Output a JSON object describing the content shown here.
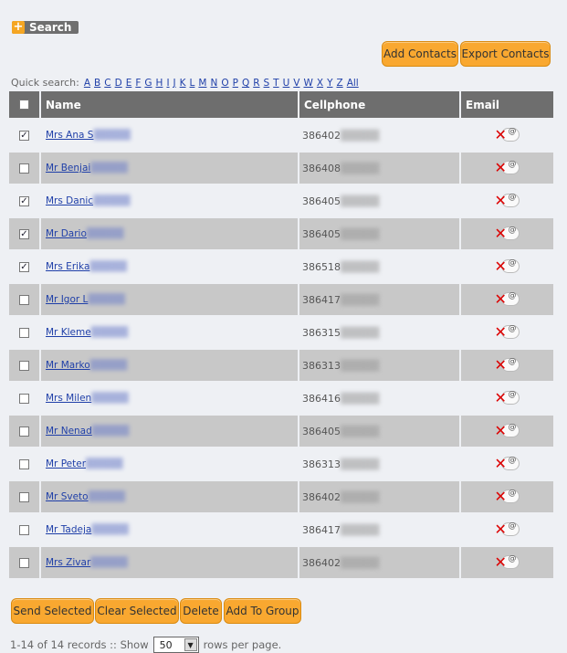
{
  "search": {
    "label": "Search",
    "icon": "plus-icon"
  },
  "top_buttons": {
    "add": "Add Contacts",
    "export": "Export Contacts"
  },
  "quick_search": {
    "label": "Quick search:",
    "letters": [
      "A",
      "B",
      "C",
      "D",
      "E",
      "F",
      "G",
      "H",
      "I",
      "J",
      "K",
      "L",
      "M",
      "N",
      "O",
      "P",
      "Q",
      "R",
      "S",
      "T",
      "U",
      "V",
      "W",
      "X",
      "Y",
      "Z",
      "All"
    ]
  },
  "table": {
    "headers": {
      "name": "Name",
      "cellphone": "Cellphone",
      "email": "Email"
    },
    "rows": [
      {
        "name": "Mrs Ana S",
        "phone": "386402",
        "checked": true
      },
      {
        "name": "Mr Benjai",
        "phone": "386408",
        "checked": false
      },
      {
        "name": "Mrs Danic",
        "phone": "386405",
        "checked": true
      },
      {
        "name": "Mr Dario",
        "phone": "386405",
        "checked": true
      },
      {
        "name": "Mrs Erika",
        "phone": "386518",
        "checked": true
      },
      {
        "name": "Mr Igor L",
        "phone": "386417",
        "checked": false
      },
      {
        "name": "Mr Kleme",
        "phone": "386315",
        "checked": false
      },
      {
        "name": "Mr Marko",
        "phone": "386313",
        "checked": false
      },
      {
        "name": "Mrs Milen",
        "phone": "386416",
        "checked": false
      },
      {
        "name": "Mr Nenad",
        "phone": "386405",
        "checked": false
      },
      {
        "name": "Mr Peter",
        "phone": "386313",
        "checked": false
      },
      {
        "name": "Mr Sveto",
        "phone": "386402",
        "checked": false
      },
      {
        "name": "Mr Tadeja",
        "phone": "386417",
        "checked": false
      },
      {
        "name": "Mrs Zivar",
        "phone": "386402",
        "checked": false
      }
    ]
  },
  "bottom_buttons": {
    "send": "Send Selected",
    "clear": "Clear Selected",
    "delete": "Delete",
    "group": "Add To Group"
  },
  "footer": {
    "records": "1-14 of 14 records :: Show",
    "rows_value": "50",
    "suffix": "rows per page."
  },
  "colors": {
    "accent": "#f9a830",
    "header": "#6e6e6e",
    "link": "#1f3fa8",
    "row_dark": "#c8c8c8",
    "row_light": "#eef0f4"
  }
}
